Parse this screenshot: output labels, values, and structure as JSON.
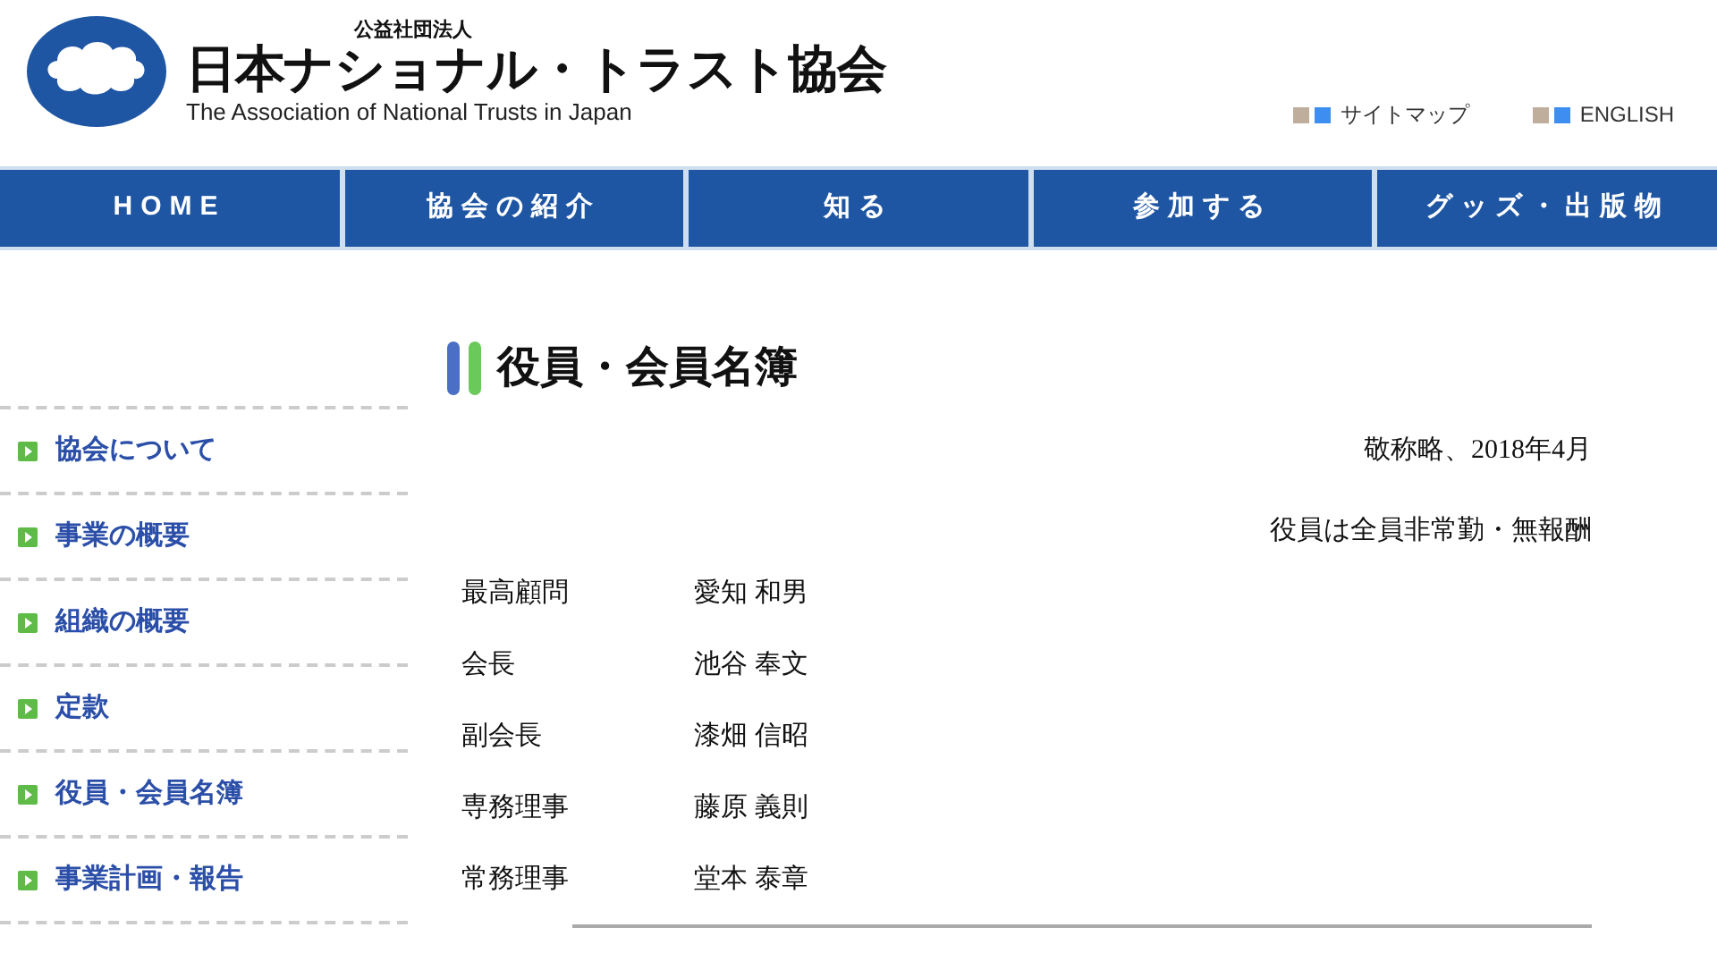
{
  "header": {
    "org_type": "公益社団法人",
    "org_name": "日本ナショナル・トラスト協会",
    "org_name_en": "The Association of National Trusts in Japan",
    "links": [
      {
        "label": "サイトマップ"
      },
      {
        "label": "ENGLISH"
      }
    ]
  },
  "nav": [
    {
      "label": "HOME"
    },
    {
      "label": "協会の紹介"
    },
    {
      "label": "知る"
    },
    {
      "label": "参加する"
    },
    {
      "label": "グッズ・出版物"
    }
  ],
  "sidebar": {
    "items": [
      {
        "label": "協会について"
      },
      {
        "label": "事業の概要"
      },
      {
        "label": "組織の概要"
      },
      {
        "label": "定款"
      },
      {
        "label": "役員・会員名簿"
      },
      {
        "label": "事業計画・報告"
      }
    ]
  },
  "page": {
    "title": "役員・会員名簿",
    "date_note": "敬称略、2018年4月",
    "note": "役員は全員非常勤・無報酬",
    "officers": [
      {
        "role": "最高顧問",
        "name": "愛知 和男"
      },
      {
        "role": "会長",
        "name": "池谷 奉文"
      },
      {
        "role": "副会長",
        "name": "漆畑 信昭"
      },
      {
        "role": "専務理事",
        "name": "藤原 義則"
      },
      {
        "role": "常務理事",
        "name": "堂本 泰章"
      }
    ]
  }
}
